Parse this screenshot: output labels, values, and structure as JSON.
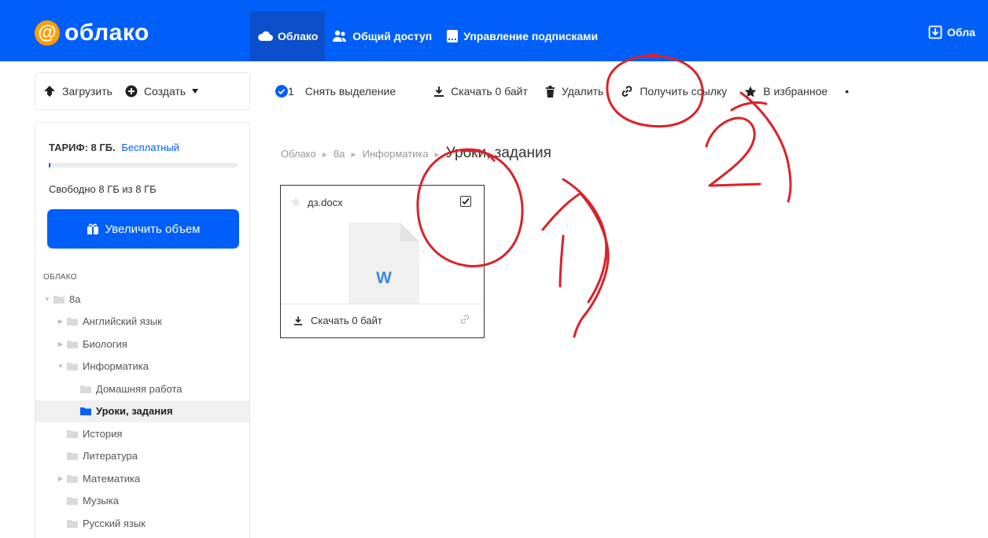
{
  "header": {
    "logo": "облако",
    "nav": [
      {
        "label": "Облако",
        "icon": "cloud-icon",
        "active": true
      },
      {
        "label": "Общий доступ",
        "icon": "users-icon",
        "active": false
      },
      {
        "label": "Управление подписками",
        "icon": "subscriptions-icon",
        "active": false
      }
    ],
    "right_label": "Обла"
  },
  "actions": {
    "upload": "Загрузить",
    "create": "Создать"
  },
  "toolbar": {
    "selected_count": "1",
    "deselect": "Снять выделение",
    "download": "Скачать 0 байт",
    "delete": "Удалить",
    "get_link": "Получить ссылку",
    "favorite": "В избранное"
  },
  "sidebar": {
    "tariff_label": "ТАРИФ: 8 ГБ.",
    "tariff_plan": "Бесплатный",
    "quota_used_fraction": 0.01,
    "quota_text": "Свободно 8 ГБ из 8 ГБ",
    "increase_button": "Увеличить объем",
    "section_label": "ОБЛАКО",
    "tree": [
      {
        "label": "8а",
        "level": 0,
        "arrow": "▼",
        "active": false
      },
      {
        "label": "Английский язык",
        "level": 1,
        "arrow": "▶",
        "active": false
      },
      {
        "label": "Биология",
        "level": 1,
        "arrow": "▶",
        "active": false
      },
      {
        "label": "Информатика",
        "level": 1,
        "arrow": "▼",
        "active": false
      },
      {
        "label": "Домашняя работа",
        "level": 2,
        "arrow": "",
        "active": false
      },
      {
        "label": "Уроки, задания",
        "level": 2,
        "arrow": "",
        "active": true
      },
      {
        "label": "История",
        "level": 1,
        "arrow": "",
        "active": false
      },
      {
        "label": "Литература",
        "level": 1,
        "arrow": "",
        "active": false
      },
      {
        "label": "Математика",
        "level": 1,
        "arrow": "▶",
        "active": false
      },
      {
        "label": "Музыка",
        "level": 1,
        "arrow": "",
        "active": false
      },
      {
        "label": "Русский язык",
        "level": 1,
        "arrow": "",
        "active": false
      }
    ]
  },
  "breadcrumb": {
    "items": [
      "Облако",
      "8а",
      "Информатика"
    ],
    "current": "Уроки, задания"
  },
  "file": {
    "name": "дз.docx",
    "type_letter": "W",
    "checked": true,
    "download": "Скачать 0 байт"
  },
  "colors": {
    "brand": "#005ff9",
    "brand_dark": "#0b4fcc",
    "annotation": "#d8232a"
  }
}
